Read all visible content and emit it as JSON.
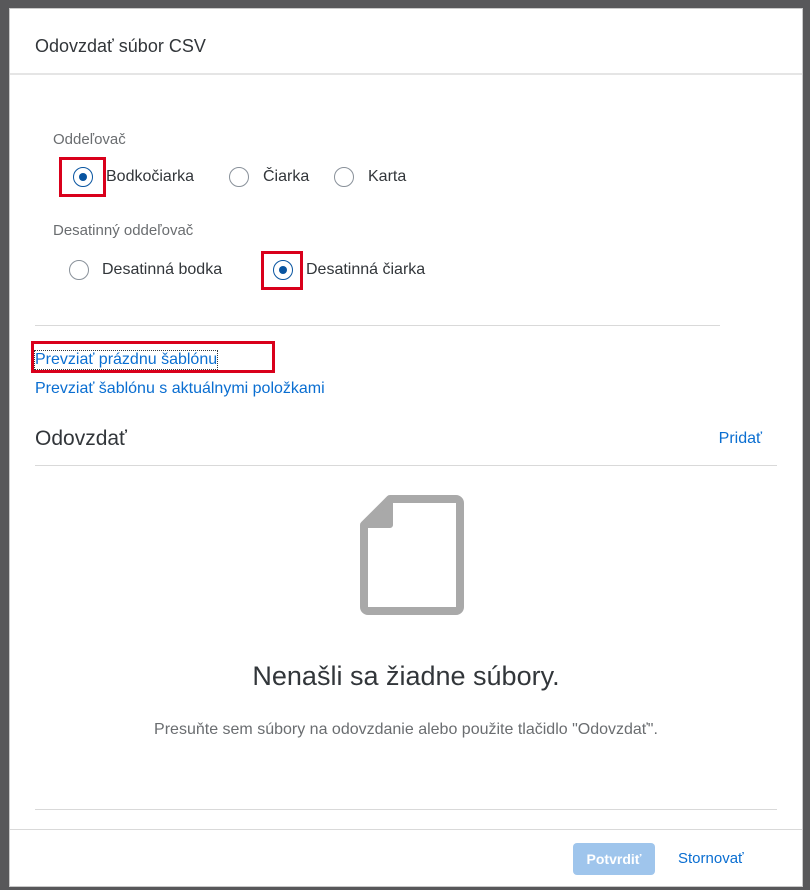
{
  "dialog": {
    "title": "Odovzdať súbor CSV"
  },
  "separator_field": {
    "label": "Oddeľovač",
    "options": [
      {
        "label": "Bodkočiarka",
        "selected": true
      },
      {
        "label": "Čiarka",
        "selected": false
      },
      {
        "label": "Karta",
        "selected": false
      }
    ]
  },
  "decimal_field": {
    "label": "Desatinný oddeľovač",
    "options": [
      {
        "label": "Desatinná bodka",
        "selected": false
      },
      {
        "label": "Desatinná čiarka",
        "selected": true
      }
    ]
  },
  "links": {
    "empty_template": "Prevziať prázdnu šablónu",
    "template_with_items": "Prevziať šablónu s aktuálnymi položkami"
  },
  "upload": {
    "title": "Odovzdať",
    "add_label": "Pridať",
    "empty_title": "Nenašli sa žiadne súbory.",
    "empty_description": "Presuňte sem súbory na odovzdanie alebo použite tlačidlo \"Odovzdať\".",
    "empty_icon": "document-icon"
  },
  "footer": {
    "confirm_label": "Potvrdiť",
    "cancel_label": "Stornovať"
  },
  "colors": {
    "accent": "#0a6ed1",
    "radio_selected": "#0854a0",
    "highlight": "#d9001b",
    "button_disabled": "#9fc5ec"
  }
}
